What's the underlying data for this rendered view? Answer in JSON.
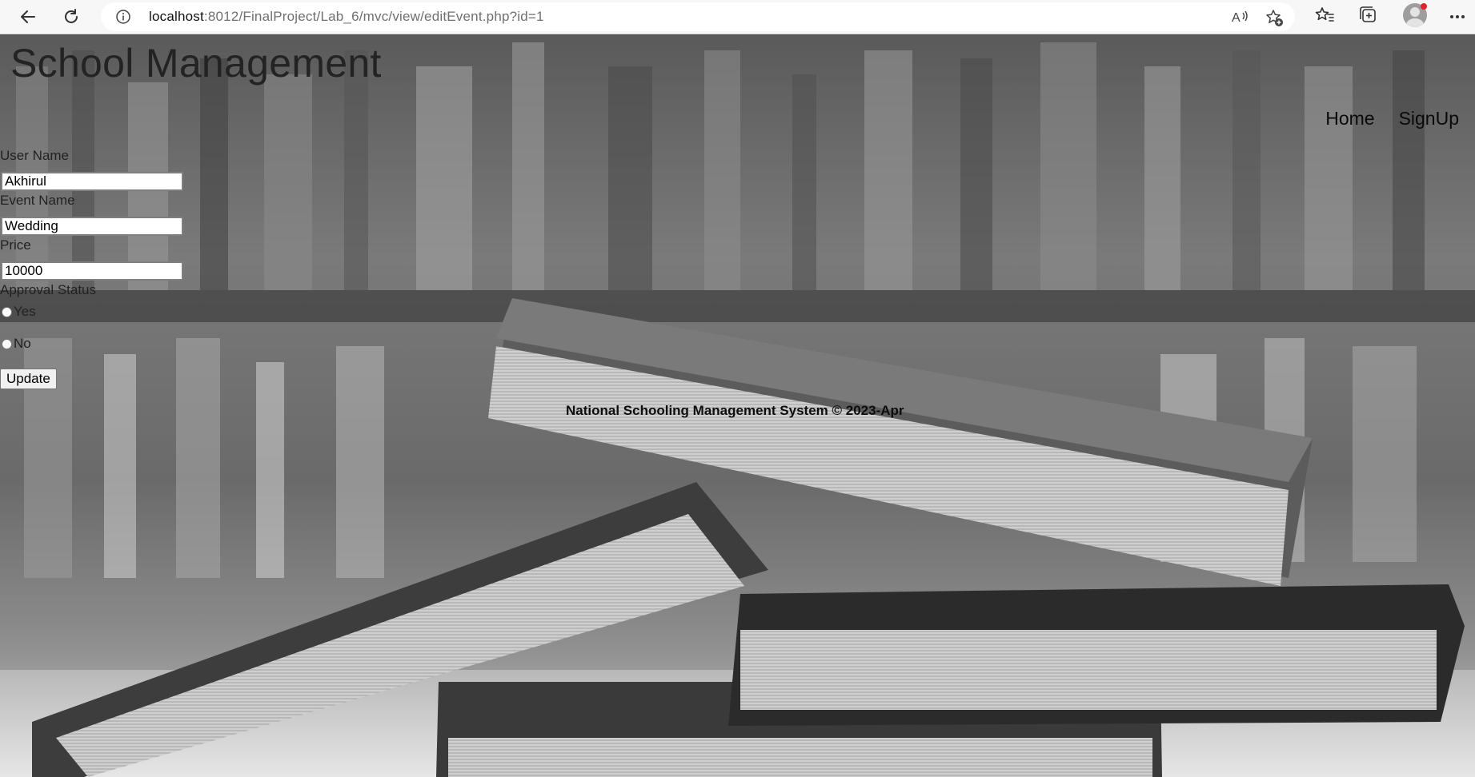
{
  "browser": {
    "url_host": "localhost",
    "url_path": ":8012/FinalProject/Lab_6/mvc/view/editEvent.php?id=1"
  },
  "page": {
    "title": "School Management",
    "nav": [
      "Home",
      "SignUp"
    ]
  },
  "form": {
    "user_name_label": "User Name",
    "user_name_value": "Akhirul",
    "event_name_label": "Event Name",
    "event_name_value": "Wedding",
    "price_label": "Price",
    "price_value": "10000",
    "approval_label": "Approval Status",
    "options": [
      "Yes",
      "No"
    ],
    "update_label": "Update"
  },
  "footer": "National Schooling Management System © 2023-Apr",
  "colors": {
    "chrome_bg": "#f7f7f7",
    "notification_dot": "#e0242b"
  }
}
